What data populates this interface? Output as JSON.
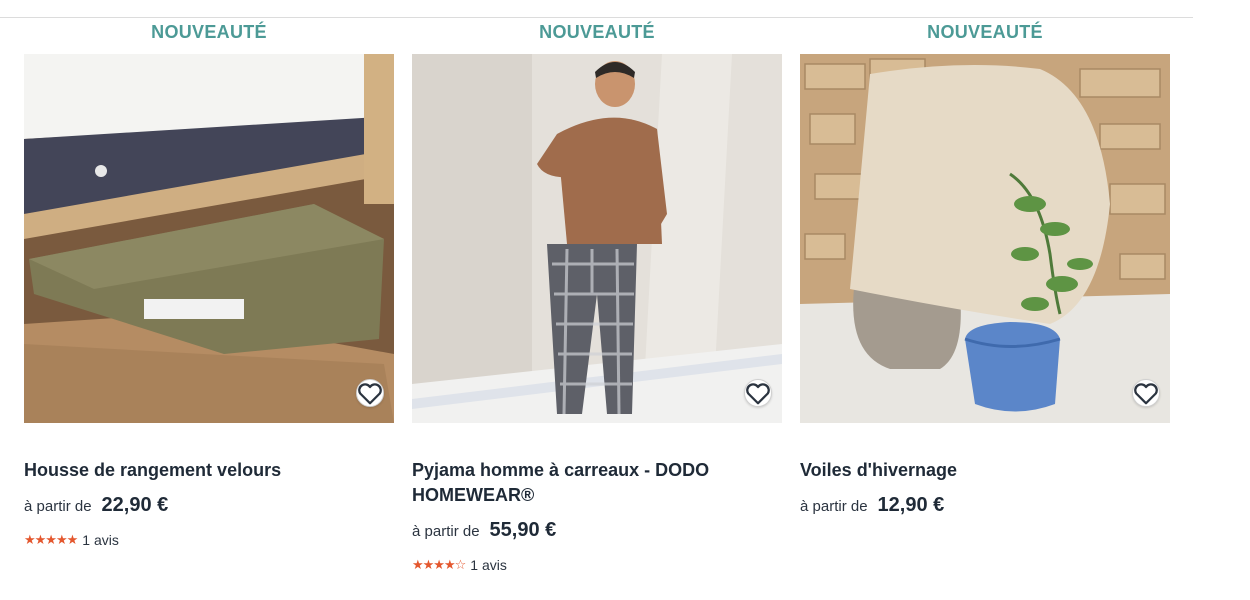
{
  "products": [
    {
      "badge": "NOUVEAUTÉ",
      "title": "Housse de rangement velours",
      "price_prefix": "à partir de",
      "price": "22,90 €",
      "stars": "★★★★★",
      "rating_value": 5,
      "reviews": "1 avis",
      "image_icon": "under-bed-storage-bag-photo"
    },
    {
      "badge": "NOUVEAUTÉ",
      "title": "Pyjama homme à carreaux - DODO HOMEWEAR®",
      "price_prefix": "à partir de",
      "price": "55,90 €",
      "stars": "★★★★☆",
      "rating_value": 4,
      "reviews": "1 avis",
      "image_icon": "man-in-pyjamas-photo"
    },
    {
      "badge": "NOUVEAUTÉ",
      "title": "Voiles d'hivernage",
      "price_prefix": "à partir de",
      "price": "12,90 €",
      "image_icon": "plant-winter-cover-photo"
    }
  ],
  "colors": {
    "badge": "#4c9a96",
    "stars": "#e4572e",
    "text": "#1f2a37"
  },
  "icons": {
    "wishlist": "heart-outline-icon"
  }
}
